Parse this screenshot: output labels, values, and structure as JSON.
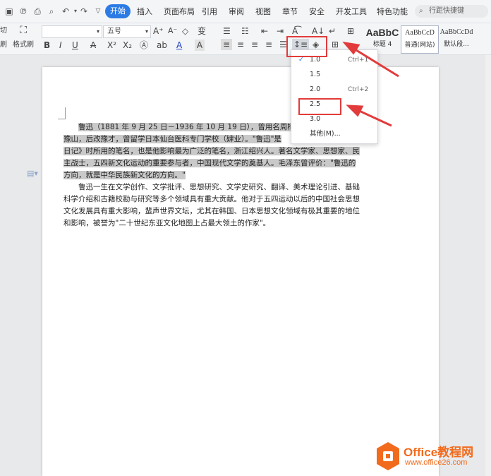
{
  "menubar": {
    "tabs": [
      "开始",
      "插入",
      "页面布局",
      "引用",
      "审阅",
      "视图",
      "章节",
      "安全",
      "开发工具",
      "特色功能"
    ],
    "active_tab": "开始",
    "search_placeholder": "行距快捷键"
  },
  "ribbon": {
    "cut_label": "切",
    "format_painter_label": "格式刷",
    "brush_label": "刷",
    "font_size": "五号",
    "styles": [
      {
        "preview": "AaBbC",
        "name": "标题 4"
      },
      {
        "preview": "AaBbCcD",
        "name": "普通(网站)"
      },
      {
        "preview": "AaBbCcDd",
        "name": "默认段..."
      }
    ]
  },
  "line_spacing_menu": {
    "options": [
      {
        "label": "1.0",
        "shortcut": "Ctrl+1",
        "checked": true
      },
      {
        "label": "1.5",
        "shortcut": ""
      },
      {
        "label": "2.0",
        "shortcut": "Ctrl+2"
      },
      {
        "label": "2.5",
        "shortcut": ""
      },
      {
        "label": "3.0",
        "shortcut": ""
      },
      {
        "label": "其他(M)...",
        "shortcut": ""
      }
    ]
  },
  "document": {
    "para1_lines": [
      "鲁迅（1881 年 9 月 25 日－1936 年 10 月 19 日），曾用名周樟",
      "豫山，后改豫才，曾留学日本仙台医科专门学校（肄业）。\"鲁迅\"是",
      "日记》时所用的笔名，也是他影响最为广泛的笔名，浙江绍兴人。著名文学家、思想家、民",
      "主战士，五四新文化运动的重要参与者，中国现代文学的奠基人。毛泽东曾评价：\"鲁迅的",
      "方向，就是中华民族新文化的方向。\""
    ],
    "para2_lines": [
      "鲁迅一生在文学创作、文学批评、思想研究、文学史研究、翻译、美术理论引进、基础",
      "科学介绍和古籍校勘与研究等多个领域具有重大贡献。他对于五四运动以后的中国社会思想",
      "文化发展具有重大影响，蜚声世界文坛，尤其在韩国、日本思想文化领域有极其重要的地位",
      "和影响，被誉为\"二十世纪东亚文化地图上占最大领土的作家\"。"
    ]
  },
  "watermark": {
    "brand": "Office教程网",
    "url": "www.office26.com"
  },
  "colors": {
    "accent": "#2c7be5",
    "annotation": "#e23b3b",
    "highlight": "#c9c9c9"
  }
}
